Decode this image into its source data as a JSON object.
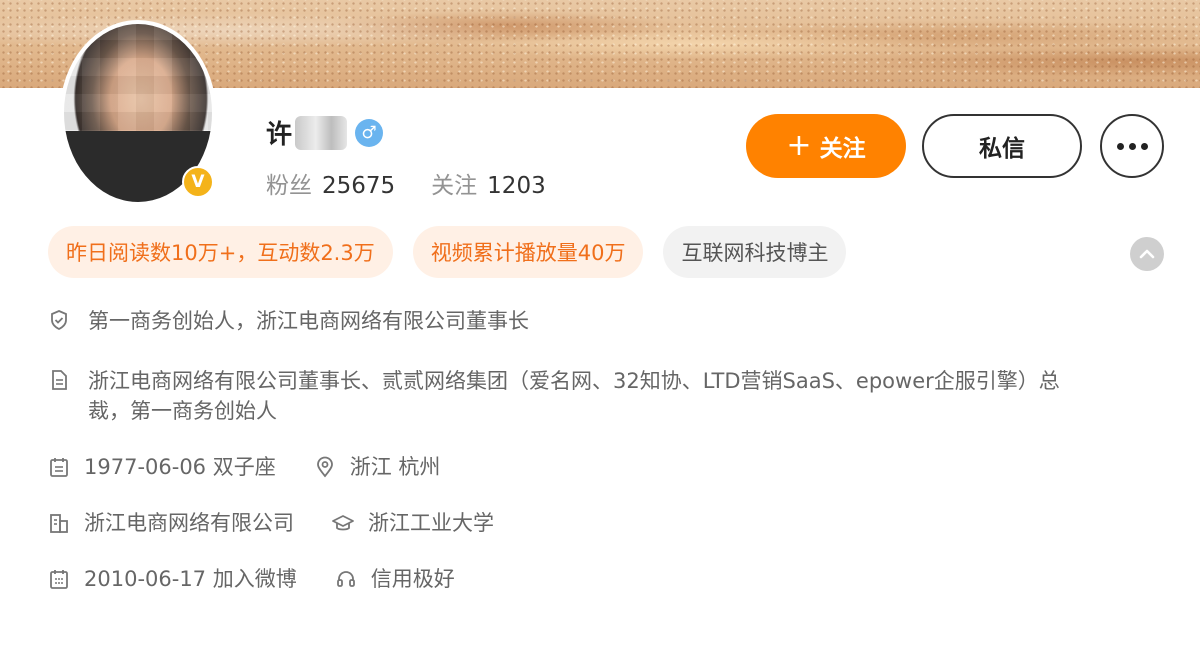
{
  "profile": {
    "name_visible": "许",
    "gender_symbol": "♂",
    "vip_badge": "V",
    "stats": {
      "followers_label": "粉丝",
      "followers_value": "25675",
      "following_label": "关注",
      "following_value": "1203"
    }
  },
  "actions": {
    "follow_plus": "+",
    "follow_label": "关注",
    "message_label": "私信"
  },
  "tags": [
    "昨日阅读数10万+，互动数2.3万",
    "视频累计播放量40万",
    "互联网科技博主"
  ],
  "info": {
    "verified_title": "第一商务创始人，浙江电商网络有限公司董事长",
    "bio_line1": "浙江电商网络有限公司董事长、贰贰网络集团（爱名网、32知协、LTD营销SaaS、epower企服引擎）总",
    "bio_line2": "裁，第一商务创始人",
    "birthday": "1977-06-06 双子座",
    "location": "浙江 杭州",
    "company": "浙江电商网络有限公司",
    "school": "浙江工业大学",
    "joined": "2010-06-17 加入微博",
    "credit": "信用极好"
  },
  "icons": {
    "verified": "shield-check-icon",
    "bio": "document-icon",
    "birthday": "calendar-icon",
    "location": "location-pin-icon",
    "company": "building-icon",
    "school": "graduation-cap-icon",
    "joined": "calendar-grid-icon",
    "credit": "credit-headset-icon",
    "collapse": "chevron-up-icon",
    "more": "more-dots-icon"
  },
  "colors": {
    "accent": "#ff8200",
    "tag_orange_bg": "#fff0e5",
    "tag_orange_text": "#f06f1b",
    "vip_gold": "#f4b31a",
    "gender_blue": "#6ab4ef"
  }
}
